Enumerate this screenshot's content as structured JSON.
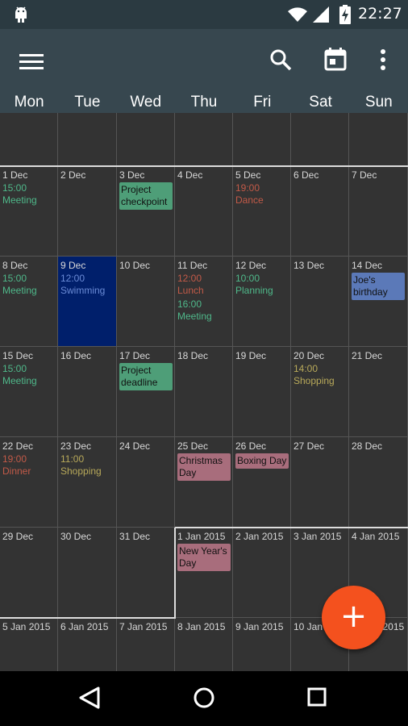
{
  "status_bar": {
    "time": "22:27"
  },
  "weekdays": [
    "Mon",
    "Tue",
    "Wed",
    "Thu",
    "Fri",
    "Sat",
    "Sun"
  ],
  "weeks": [
    [
      {
        "day": ""
      },
      {
        "day": ""
      },
      {
        "day": ""
      },
      {
        "day": ""
      },
      {
        "day": ""
      },
      {
        "day": ""
      },
      {
        "day": ""
      }
    ],
    [
      {
        "day": "1 Dec",
        "events": [
          {
            "time": "15:00",
            "title": "Meeting",
            "color": "green"
          }
        ]
      },
      {
        "day": "2 Dec"
      },
      {
        "day": "3 Dec",
        "chips": [
          {
            "label": "Project checkpoint",
            "color": "green"
          }
        ]
      },
      {
        "day": "4 Dec"
      },
      {
        "day": "5 Dec",
        "events": [
          {
            "time": "19:00",
            "title": "Dance",
            "color": "red"
          }
        ]
      },
      {
        "day": "6 Dec"
      },
      {
        "day": "7 Dec"
      }
    ],
    [
      {
        "day": "8 Dec",
        "events": [
          {
            "time": "15:00",
            "title": "Meeting",
            "color": "green"
          }
        ]
      },
      {
        "day": "9 Dec",
        "today": true,
        "events": [
          {
            "time": "12:00",
            "title": "Swimming",
            "color": "blue"
          }
        ]
      },
      {
        "day": "10 Dec"
      },
      {
        "day": "11 Dec",
        "events": [
          {
            "time": "12:00",
            "title": "Lunch",
            "color": "red"
          },
          {
            "time": "16:00",
            "title": "Meeting",
            "color": "green"
          }
        ]
      },
      {
        "day": "12 Dec",
        "events": [
          {
            "time": "10:00",
            "title": "Planning",
            "color": "green"
          }
        ]
      },
      {
        "day": "13 Dec"
      },
      {
        "day": "14 Dec",
        "chips": [
          {
            "label": "Joe's birthday",
            "color": "blue"
          }
        ]
      }
    ],
    [
      {
        "day": "15 Dec",
        "events": [
          {
            "time": "15:00",
            "title": "Meeting",
            "color": "green"
          }
        ]
      },
      {
        "day": "16 Dec"
      },
      {
        "day": "17 Dec",
        "chips": [
          {
            "label": "Project deadline",
            "color": "green"
          }
        ]
      },
      {
        "day": "18 Dec"
      },
      {
        "day": "19 Dec"
      },
      {
        "day": "20 Dec",
        "events": [
          {
            "time": "14:00",
            "title": "Shopping",
            "color": "yellow"
          }
        ]
      },
      {
        "day": "21 Dec"
      }
    ],
    [
      {
        "day": "22 Dec",
        "events": [
          {
            "time": "19:00",
            "title": "Dinner",
            "color": "red"
          }
        ]
      },
      {
        "day": "23 Dec",
        "events": [
          {
            "time": "11:00",
            "title": "Shopping",
            "color": "yellow"
          }
        ]
      },
      {
        "day": "24 Dec"
      },
      {
        "day": "25 Dec",
        "chips": [
          {
            "label": "Christmas Day",
            "color": "pink"
          }
        ]
      },
      {
        "day": "26 Dec",
        "chips": [
          {
            "label": "Boxing Day",
            "color": "pink"
          }
        ]
      },
      {
        "day": "27 Dec"
      },
      {
        "day": "28 Dec"
      }
    ],
    [
      {
        "day": "29 Dec"
      },
      {
        "day": "30 Dec"
      },
      {
        "day": "31 Dec"
      },
      {
        "day": "1 Jan 2015",
        "chips": [
          {
            "label": "New Year's Day",
            "color": "pink"
          }
        ]
      },
      {
        "day": "2 Jan 2015"
      },
      {
        "day": "3 Jan 2015"
      },
      {
        "day": "4 Jan 2015"
      }
    ],
    [
      {
        "day": "5 Jan 2015"
      },
      {
        "day": "6 Jan 2015"
      },
      {
        "day": "7 Jan 2015"
      },
      {
        "day": "8 Jan 2015"
      },
      {
        "day": "9 Jan 2015"
      },
      {
        "day": "10 Jan 2015"
      },
      {
        "day": "11 Jan 2015"
      }
    ]
  ],
  "fab": {
    "label": "+"
  },
  "colors": {
    "toolbar": "#37474f",
    "status_bar": "#2b3a41",
    "today": "#001f6b",
    "fab": "#f4511e",
    "event_green": "#4fb88a",
    "event_red": "#c25a48",
    "event_yellow": "#b8a95a",
    "event_blue": "#6a8bd6"
  },
  "icons": {
    "status": [
      "android-icon",
      "wifi-icon",
      "signal-icon",
      "battery-charging-icon"
    ],
    "toolbar": [
      "menu-icon",
      "search-icon",
      "calendar-today-icon",
      "more-vert-icon"
    ],
    "nav": [
      "back-icon",
      "home-icon",
      "recent-apps-icon"
    ]
  }
}
